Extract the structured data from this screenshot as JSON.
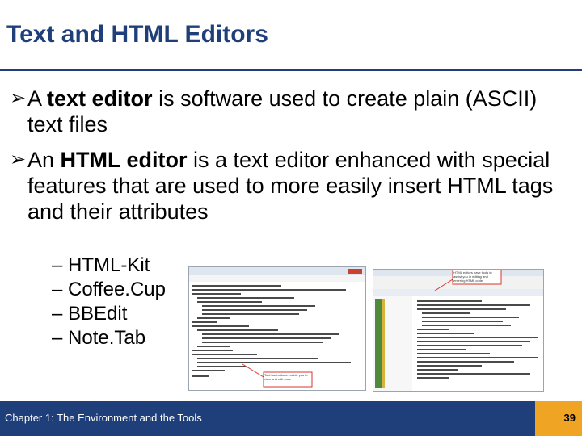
{
  "slide": {
    "title": "Text and HTML Editors",
    "bullets": [
      {
        "pre": "A ",
        "bold": "text editor",
        "post": " is software used to create plain (ASCII) text files"
      },
      {
        "pre": "An ",
        "bold": "HTML editor",
        "post": " is a text editor enhanced with special features that are used to more easily insert HTML tags and their attributes"
      }
    ],
    "sub_items": [
      "– HTML-Kit",
      "– Coffee.Cup",
      "– BBEdit",
      "– Note.Tab"
    ],
    "screenshot_1": {
      "callout": "Tool bar buttons enable you to view and edit code"
    },
    "screenshot_2": {
      "callout": "HTML editors have tools to assist you in editing and entering HTML code"
    }
  },
  "footer": {
    "text": "Chapter 1: The Environment and the Tools",
    "page": "39"
  },
  "colors": {
    "title": "#1f3f7a",
    "footer_bar": "#1f3f7a",
    "page_box": "#f0a424",
    "callout_border": "#d9342b"
  }
}
